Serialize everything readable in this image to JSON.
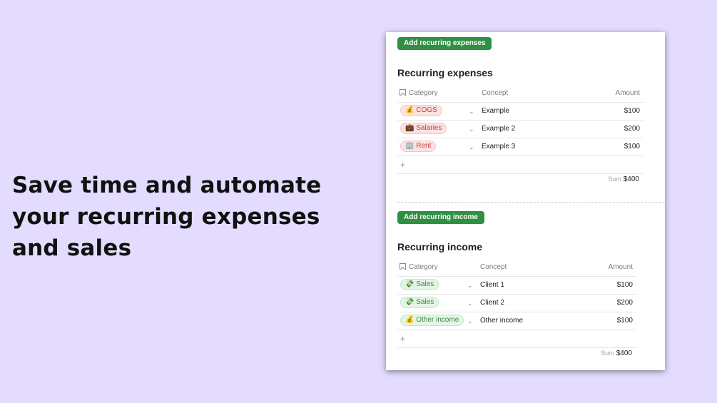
{
  "headline": {
    "line1": "Save time and automate",
    "line2": "your recurring expenses",
    "line3": "and sales"
  },
  "expenses": {
    "button_label": "Add recurring expenses",
    "title": "Recurring expenses",
    "headers": {
      "category": "Category",
      "concept": "Concept",
      "amount": "Amount"
    },
    "rows": [
      {
        "emoji": "💰",
        "category": "COGS",
        "concept": "Example",
        "amount": "$100"
      },
      {
        "emoji": "💼",
        "category": "Salaries",
        "concept": "Example 2",
        "amount": "$200"
      },
      {
        "emoji": "🏢",
        "category": "Rent",
        "concept": "Example 3",
        "amount": "$100"
      }
    ],
    "add_row": "+",
    "sum_label": "Sum",
    "sum_value": "$400"
  },
  "income": {
    "button_label": "Add recurring income",
    "title": "Recurring income",
    "headers": {
      "category": "Category",
      "concept": "Concept",
      "amount": "Amount"
    },
    "rows": [
      {
        "emoji": "💸",
        "category": "Sales",
        "concept": "Client 1",
        "amount": "$100"
      },
      {
        "emoji": "💸",
        "category": "Sales",
        "concept": "Client 2",
        "amount": "$200"
      },
      {
        "emoji": "💰",
        "category": "Other income",
        "concept": "Other income",
        "amount": "$100"
      }
    ],
    "add_row": "+",
    "sum_label": "Sum",
    "sum_value": "$400"
  },
  "chevron": "⌄",
  "colors": {
    "background": "#e4dcfe",
    "button": "#2f8f43",
    "expense_tag": "#fde2e1",
    "income_tag": "#e4f5e6"
  }
}
